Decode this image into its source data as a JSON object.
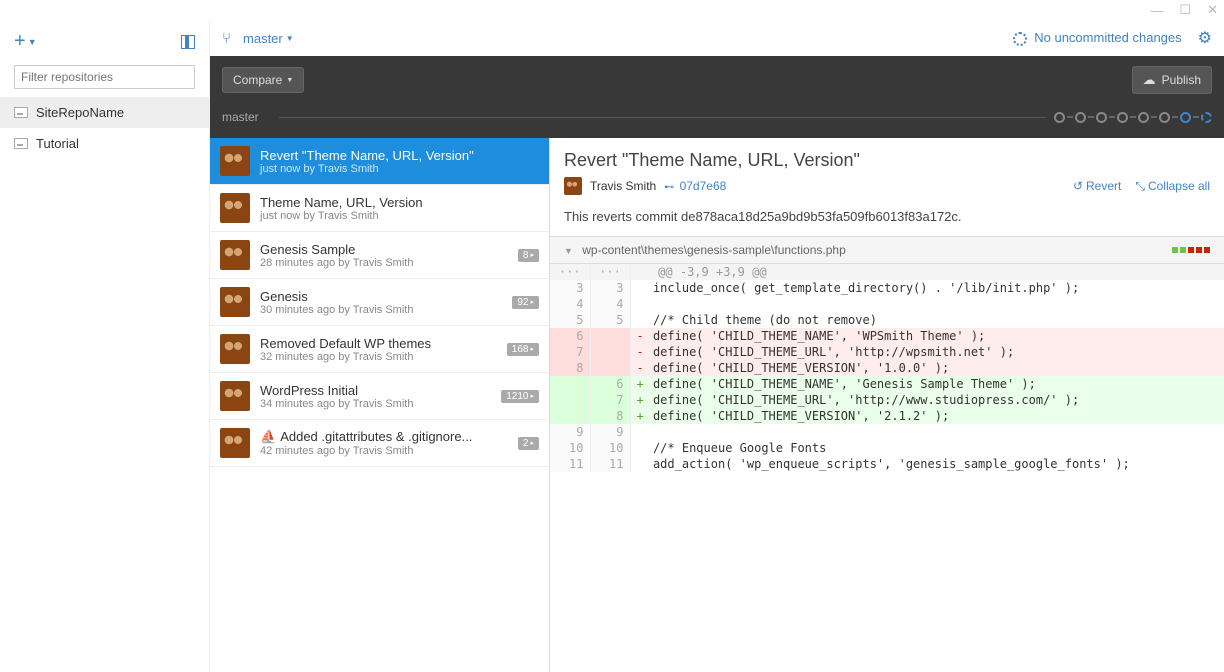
{
  "window": {
    "minimize": "—",
    "maximize": "☐",
    "close": "✕"
  },
  "sidebar": {
    "filter_placeholder": "Filter repositories",
    "repos": [
      {
        "name": "SiteRepoName",
        "active": true
      },
      {
        "name": "Tutorial",
        "active": false
      }
    ]
  },
  "toolbar": {
    "branch": "master",
    "uncommitted": "No uncommitted changes"
  },
  "darkbar": {
    "compare": "Compare",
    "publish": "Publish"
  },
  "timeline": {
    "label": "master",
    "dots": 8
  },
  "commits": [
    {
      "title": "Revert \"Theme Name, URL, Version\"",
      "meta": "just now by Travis Smith",
      "selected": true
    },
    {
      "title": "Theme Name, URL, Version",
      "meta": "just now by Travis Smith"
    },
    {
      "title": "Genesis Sample",
      "meta": "28 minutes ago by Travis Smith",
      "badge": "8"
    },
    {
      "title": "Genesis",
      "meta": "30 minutes ago by Travis Smith",
      "badge": "92"
    },
    {
      "title": "Removed Default WP themes",
      "meta": "32 minutes ago by Travis Smith",
      "badge": "168"
    },
    {
      "title": "WordPress Initial",
      "meta": "34 minutes ago by Travis Smith",
      "badge": "1210"
    },
    {
      "title": "Added .gitattributes & .gitignore...",
      "meta": "42 minutes ago by Travis Smith",
      "badge": "2",
      "bot": true
    }
  ],
  "detail": {
    "title": "Revert \"Theme Name, URL, Version\"",
    "author": "Travis Smith",
    "sha": "07d7e68",
    "revert": "Revert",
    "collapse": "Collapse all",
    "message": "This reverts commit de878aca18d25a9bd9b53fa509fb6013f83a172c.",
    "file": "wp-content\\themes\\genesis-sample\\functions.php"
  },
  "diff": {
    "hunk": "@@ -3,9 +3,9 @@",
    "lines": [
      {
        "l": "3",
        "r": "3",
        "t": "ctx",
        "c": "include_once( get_template_directory() . '/lib/init.php' );"
      },
      {
        "l": "4",
        "r": "4",
        "t": "ctx",
        "c": ""
      },
      {
        "l": "5",
        "r": "5",
        "t": "ctx",
        "c": "//* Child theme (do not remove)"
      },
      {
        "l": "6",
        "r": "",
        "t": "del",
        "c": "define( 'CHILD_THEME_NAME', 'WPSmith Theme' );"
      },
      {
        "l": "7",
        "r": "",
        "t": "del",
        "c": "define( 'CHILD_THEME_URL', 'http://wpsmith.net' );"
      },
      {
        "l": "8",
        "r": "",
        "t": "del",
        "c": "define( 'CHILD_THEME_VERSION', '1.0.0' );"
      },
      {
        "l": "",
        "r": "6",
        "t": "add",
        "c": "define( 'CHILD_THEME_NAME', 'Genesis Sample Theme' );"
      },
      {
        "l": "",
        "r": "7",
        "t": "add",
        "c": "define( 'CHILD_THEME_URL', 'http://www.studiopress.com/' );"
      },
      {
        "l": "",
        "r": "8",
        "t": "add",
        "c": "define( 'CHILD_THEME_VERSION', '2.1.2' );"
      },
      {
        "l": "9",
        "r": "9",
        "t": "ctx",
        "c": ""
      },
      {
        "l": "10",
        "r": "10",
        "t": "ctx",
        "c": "//* Enqueue Google Fonts"
      },
      {
        "l": "11",
        "r": "11",
        "t": "ctx",
        "c": "add_action( 'wp_enqueue_scripts', 'genesis_sample_google_fonts' );"
      }
    ]
  }
}
